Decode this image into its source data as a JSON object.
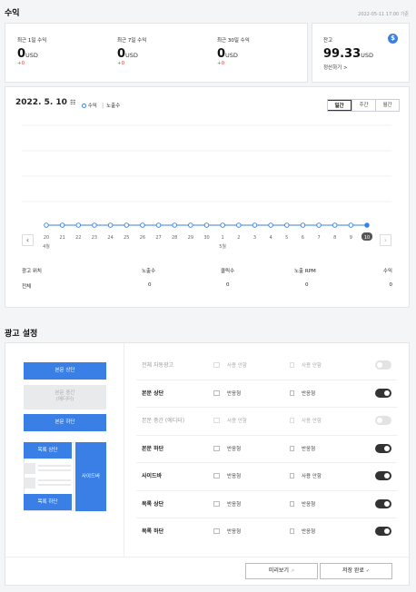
{
  "header": {
    "title": "수익",
    "timestamp": "2022-05-11 17:00 기준"
  },
  "summary": [
    {
      "label": "최근 1일 수익",
      "value": "0",
      "unit": "USD",
      "delta": "+0"
    },
    {
      "label": "최근 7일 수익",
      "value": "0",
      "unit": "USD",
      "delta": "+0"
    },
    {
      "label": "최근 30일 수익",
      "value": "0",
      "unit": "USD",
      "delta": "+0"
    }
  ],
  "balance": {
    "label": "잔고",
    "value": "99.33",
    "unit": "USD",
    "link": "정산하기 >",
    "icon": "dollar-icon"
  },
  "chart_panel": {
    "date": "2022. 5. 10",
    "legend": [
      "수익",
      "노출수"
    ],
    "tabs": [
      "일간",
      "주간",
      "월간"
    ],
    "prev": "‹",
    "next": "›"
  },
  "chart_data": {
    "type": "line",
    "x": [
      "20",
      "21",
      "22",
      "23",
      "24",
      "25",
      "26",
      "27",
      "28",
      "29",
      "30",
      "1",
      "2",
      "3",
      "4",
      "5",
      "6",
      "7",
      "8",
      "9",
      "10"
    ],
    "month_labels": [
      "4월",
      "5월"
    ],
    "series": [
      {
        "name": "수익",
        "values": [
          0,
          0,
          0,
          0,
          0,
          0,
          0,
          0,
          0,
          0,
          0,
          0,
          0,
          0,
          0,
          0,
          0,
          0,
          0,
          0,
          0
        ]
      }
    ],
    "colors": {
      "line": "#3a7fe6",
      "selected_bg": "#555555"
    }
  },
  "stats_table": {
    "headers": [
      "광고 위치",
      "노출수",
      "클릭수",
      "노출 RPM",
      "수익"
    ],
    "rows": [
      [
        "전체",
        "0",
        "0",
        "0",
        "0"
      ]
    ]
  },
  "settings": {
    "title": "광고 설정",
    "preview": {
      "top": "본문 상단",
      "middle_1": "본문 중간",
      "middle_2": "(에디터)",
      "bottom": "본문 하단",
      "list_top": "목록 상단",
      "list_bottom": "목록 하단",
      "sidebar": "사이드바"
    },
    "rows": [
      {
        "label": "전체 자동광고",
        "opt1": "사용 안함",
        "opt2": "사용 안함",
        "toggle": "off",
        "disabled": true
      },
      {
        "label": "본문 상단",
        "opt1": "반응형",
        "opt2": "반응형",
        "toggle": "on",
        "disabled": false
      },
      {
        "label": "본문 중간 (에디터)",
        "opt1": "사용 안함",
        "opt2": "사용 안함",
        "toggle": "off",
        "disabled": true
      },
      {
        "label": "본문 하단",
        "opt1": "반응형",
        "opt2": "반응형",
        "toggle": "on",
        "disabled": false
      },
      {
        "label": "사이드바",
        "opt1": "반응형",
        "opt2": "사용 안함",
        "toggle": "on",
        "disabled": false
      },
      {
        "label": "목록 상단",
        "opt1": "반응형",
        "opt2": "반응형",
        "toggle": "on",
        "disabled": false
      },
      {
        "label": "목록 하단",
        "opt1": "반응형",
        "opt2": "반응형",
        "toggle": "on",
        "disabled": false
      }
    ],
    "preview_button": "미리보기",
    "save_button": "저장 완료"
  }
}
